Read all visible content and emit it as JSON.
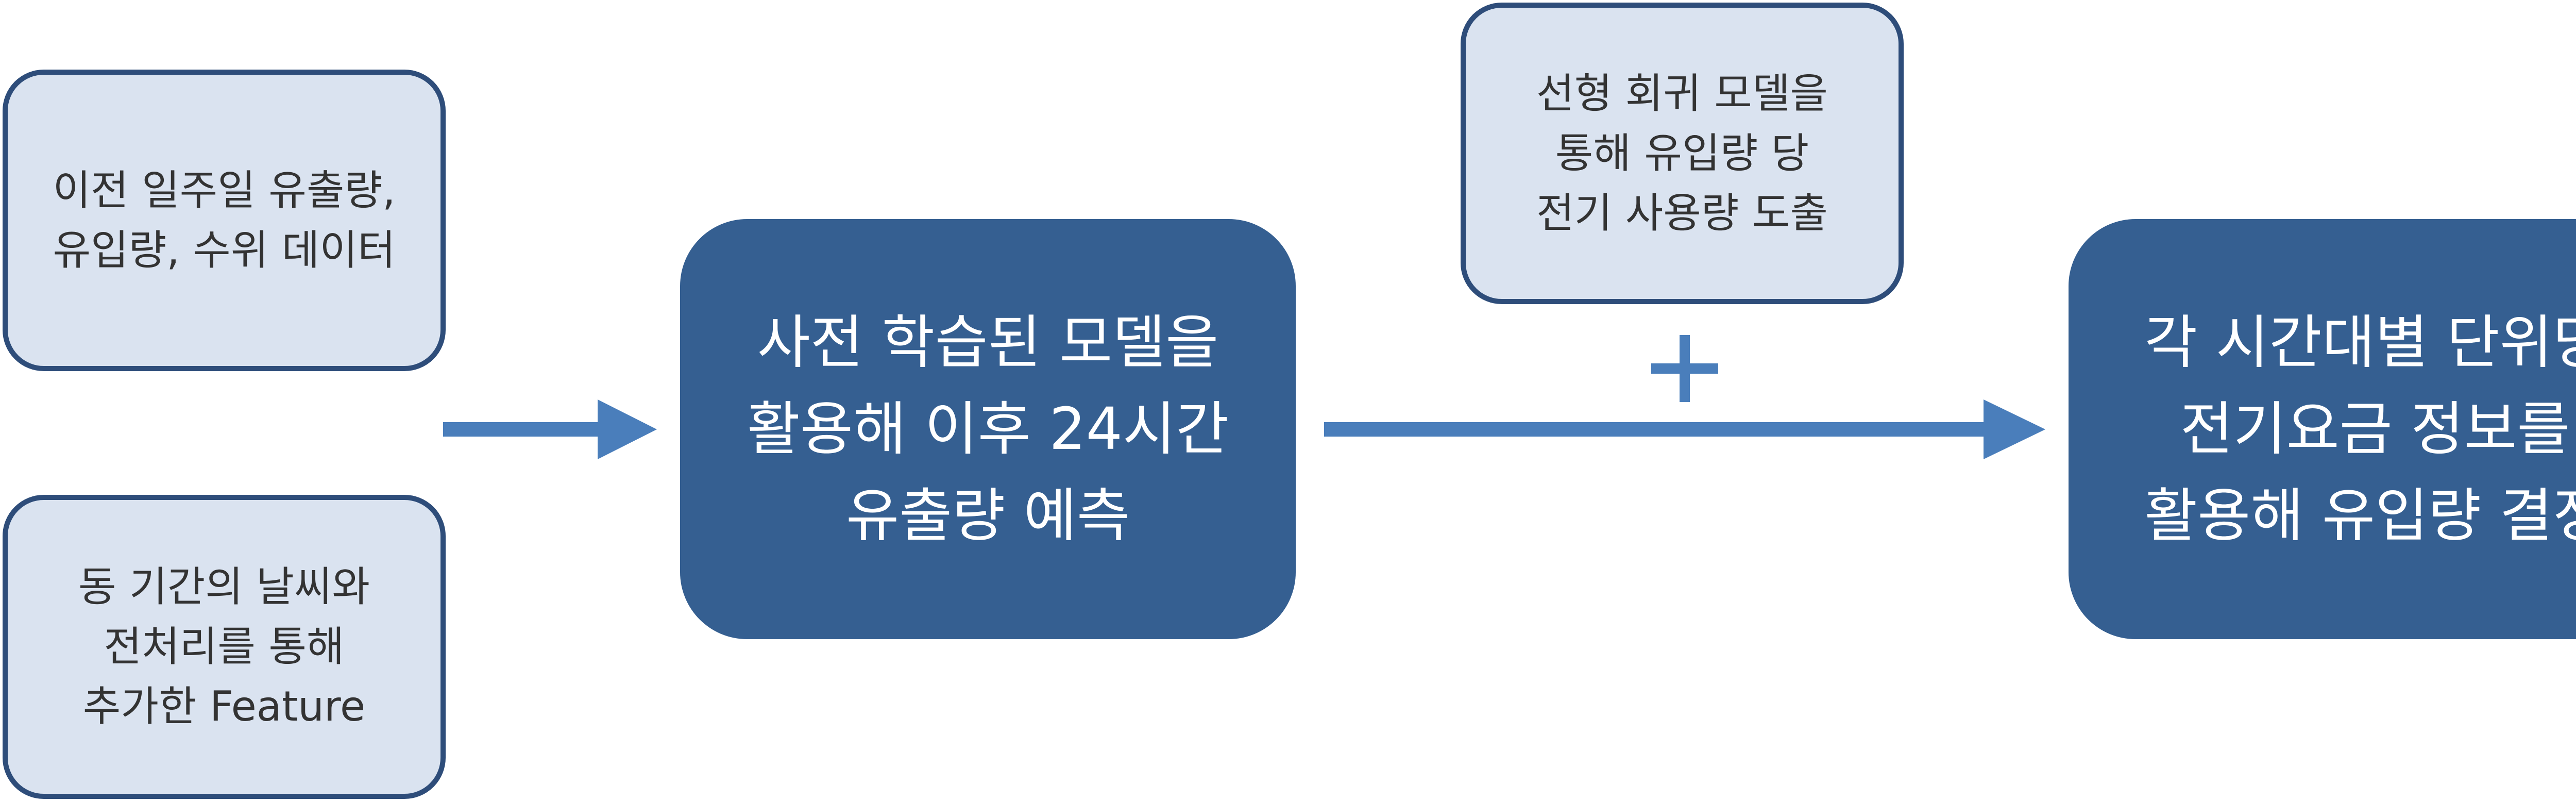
{
  "diagram": {
    "inputs": [
      {
        "lines": [
          "이전 일주일 유출량,",
          "유입량, 수위 데이터"
        ]
      },
      {
        "lines": [
          "동 기간의 날씨와",
          "전처리를 통해",
          "추가한 Feature"
        ]
      }
    ],
    "prediction": {
      "lines": [
        "사전 학습된 모델을",
        "활용해 이후 24시간",
        "유출량 예측"
      ]
    },
    "regression": {
      "lines": [
        "선형 회귀 모델을",
        "통해 유입량 당",
        "전기 사용량 도출"
      ]
    },
    "plus_sign": "+",
    "decision": {
      "lines": [
        "각 시간대별 단위당",
        "전기요금 정보를",
        "활용해 유입량 결정"
      ]
    },
    "colors": {
      "light_fill": "#dae3f0",
      "light_border": "#2e4d7a",
      "dark_fill": "#355f91",
      "arrow": "#4a7ebb"
    }
  }
}
